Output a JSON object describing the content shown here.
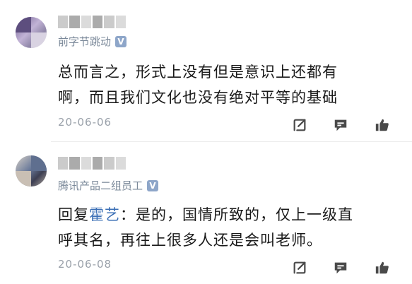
{
  "colors": {
    "icon": "#4a4a4a",
    "company_text": "#7a8899",
    "mention": "#3b6fb6",
    "meta": "#9aa1aa"
  },
  "comments": [
    {
      "company": "前字节跳动",
      "verified_badge": "V",
      "text_lines": [
        "总而言之，形式上没有但是意识上还都有",
        "啊，而且我们文化也没有绝对平等的基础"
      ],
      "date": "20-06-06",
      "icons": [
        "share-icon",
        "reply-icon",
        "like-icon"
      ]
    },
    {
      "company": "腾讯产品二组员工",
      "verified_badge": "V",
      "reply_prefix": "回复",
      "mention": "霍艺",
      "reply_text_1": "：是的，国情所致的，仅上一级直",
      "reply_text_2": "呼其名，再往上很多人还是会叫老师。",
      "date": "20-06-08",
      "icons": [
        "share-icon",
        "reply-icon",
        "like-icon"
      ]
    }
  ]
}
